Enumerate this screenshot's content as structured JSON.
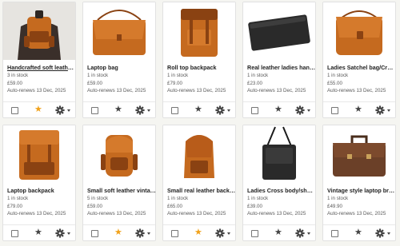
{
  "listings": [
    {
      "title": "Handcrafted soft leathe…",
      "stock": "3 in stock",
      "price": "£59.00",
      "renew": "Auto-renews 13 Dec, 2025",
      "starred": true,
      "icon": "backpack-on-person-image",
      "link": true
    },
    {
      "title": "Laptop bag",
      "stock": "1 in stock",
      "price": "£59.00",
      "renew": "Auto-renews 13 Dec, 2025",
      "starred": false,
      "icon": "laptop-bag-image"
    },
    {
      "title": "Roll top backpack",
      "stock": "1 in stock",
      "price": "£79.00",
      "renew": "Auto-renews 13 Dec, 2025",
      "starred": false,
      "icon": "roll-top-backpack-image"
    },
    {
      "title": "Real leather ladies han…",
      "stock": "1 in stock",
      "price": "£23.00",
      "renew": "Auto-renews 13 Dec, 2025",
      "starred": false,
      "icon": "black-wallet-image"
    },
    {
      "title": "Ladies Satchel bag/Cro…",
      "stock": "1 in stock",
      "price": "£55.00",
      "renew": "Auto-renews 13 Dec, 2025",
      "starred": false,
      "icon": "satchel-bag-image"
    },
    {
      "title": "Laptop backpack",
      "stock": "1 in stock",
      "price": "£79.00",
      "renew": "Auto-renews 13 Dec, 2025",
      "starred": false,
      "icon": "laptop-backpack-image"
    },
    {
      "title": "Small soft leather vinta…",
      "stock": "5 in stock",
      "price": "£59.00",
      "renew": "Auto-renews 13 Dec, 2025",
      "starred": true,
      "icon": "small-vintage-backpack-image"
    },
    {
      "title": "Small real leather back…",
      "stock": "1 in stock",
      "price": "£65.00",
      "renew": "Auto-renews 13 Dec, 2025",
      "starred": true,
      "icon": "small-leather-backpack-image"
    },
    {
      "title": "Ladies Cross body/sho…",
      "stock": "1 in stock",
      "price": "£39.00",
      "renew": "Auto-renews 13 Dec, 2025",
      "starred": false,
      "icon": "black-crossbody-bag-image"
    },
    {
      "title": "Vintage style laptop bri…",
      "stock": "1 in stock",
      "price": "£49.90",
      "renew": "Auto-renews 13 Dec, 2025",
      "starred": false,
      "icon": "brown-briefcase-image"
    }
  ],
  "colors": {
    "leather_tan": "#c56a1f",
    "leather_dark": "#8a4212",
    "black_leather": "#2a2a2a",
    "star_active": "#f1a21b",
    "star_inactive": "#444444"
  }
}
